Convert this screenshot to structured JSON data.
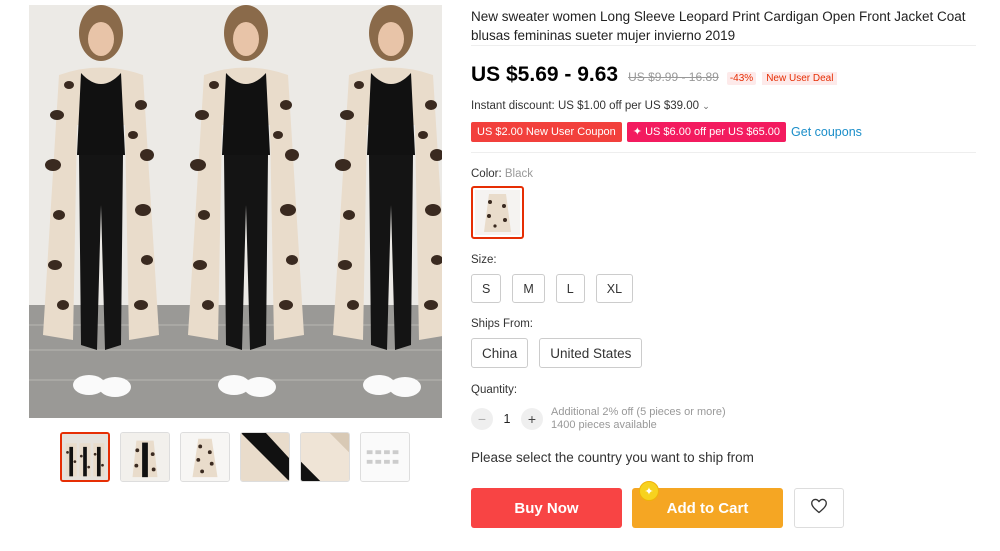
{
  "product": {
    "title": "New sweater women Long Sleeve Leopard Print Cardigan Open Front Jacket Coat blusas femininas sueter mujer invierno 2019"
  },
  "price": {
    "current": "US $5.69 - 9.63",
    "original": "US $9.99 - 16.89",
    "discount": "-43%",
    "deal": "New User Deal"
  },
  "promotions": {
    "instant": "Instant discount: US $1.00 off per US $39.00",
    "coupon_new_user": "US $2.00 New User Coupon",
    "coupon_store": "✦ US $6.00 off per US $65.00",
    "get_coupons": "Get coupons"
  },
  "color": {
    "label": "Color:",
    "selected": "Black"
  },
  "size": {
    "label": "Size:",
    "options": [
      "S",
      "M",
      "L",
      "XL"
    ]
  },
  "ships_from": {
    "label": "Ships From:",
    "options": [
      "China",
      "United States"
    ]
  },
  "quantity": {
    "label": "Quantity:",
    "value": "1",
    "minus": "−",
    "plus": "+",
    "note_discount": "Additional 2% off (5 pieces or more)",
    "note_available": "1400 pieces available"
  },
  "shipping_message": "Please select the country you want to ship from",
  "actions": {
    "buy_now": "Buy Now",
    "add_to_cart": "Add to Cart"
  },
  "colors": {
    "accent_red": "#e62e04",
    "buy_button": "#f84444",
    "cart_button": "#f5a623",
    "coupon_red": "#f2403c",
    "coupon_pink": "#f31b5f",
    "link_blue": "#1b8ec9"
  },
  "icons": {
    "chevron": "chevron-down-icon",
    "heart": "heart-icon",
    "cart_badge": "sparkle-badge-icon"
  }
}
